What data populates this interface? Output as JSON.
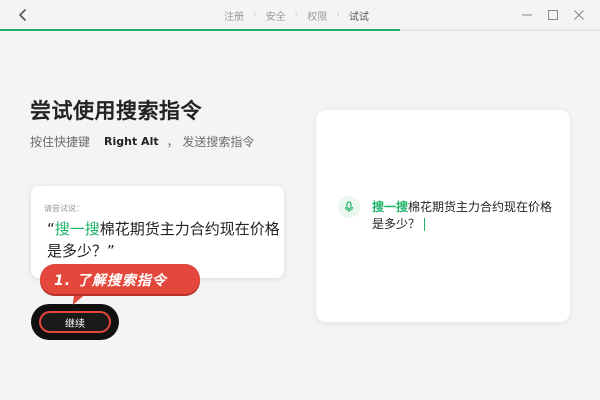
{
  "header": {
    "steps": [
      "注册",
      "安全",
      "权限",
      "试试"
    ],
    "active_step": 3,
    "progress": 0.667
  },
  "main": {
    "title": "尝试使用搜索指令",
    "subtitle_prefix": "按住快捷键",
    "shortcut_key": "Right Alt",
    "subtitle_suffix": "， 发送搜索指令",
    "try_label": "请尝试说：",
    "open_quote": "“",
    "try_keyword": "搜一搜",
    "try_rest": "棉花期货主力合约现在价格是多少？",
    "close_quote": "”",
    "continue_label": "继续"
  },
  "annotation": {
    "callout_text": "1. 了解搜索指令"
  },
  "preview": {
    "keyword": "搜一搜",
    "text": "棉花期货主力合约现在价格是多少？"
  },
  "icons": {
    "back": "chevron-left-icon",
    "minimize": "minimize-icon",
    "maximize": "maximize-icon",
    "close": "close-icon",
    "mic": "microphone-icon"
  },
  "colors": {
    "accent": "#1fb36a",
    "annotation": "#e4483c",
    "background": "#f4f4f4"
  }
}
